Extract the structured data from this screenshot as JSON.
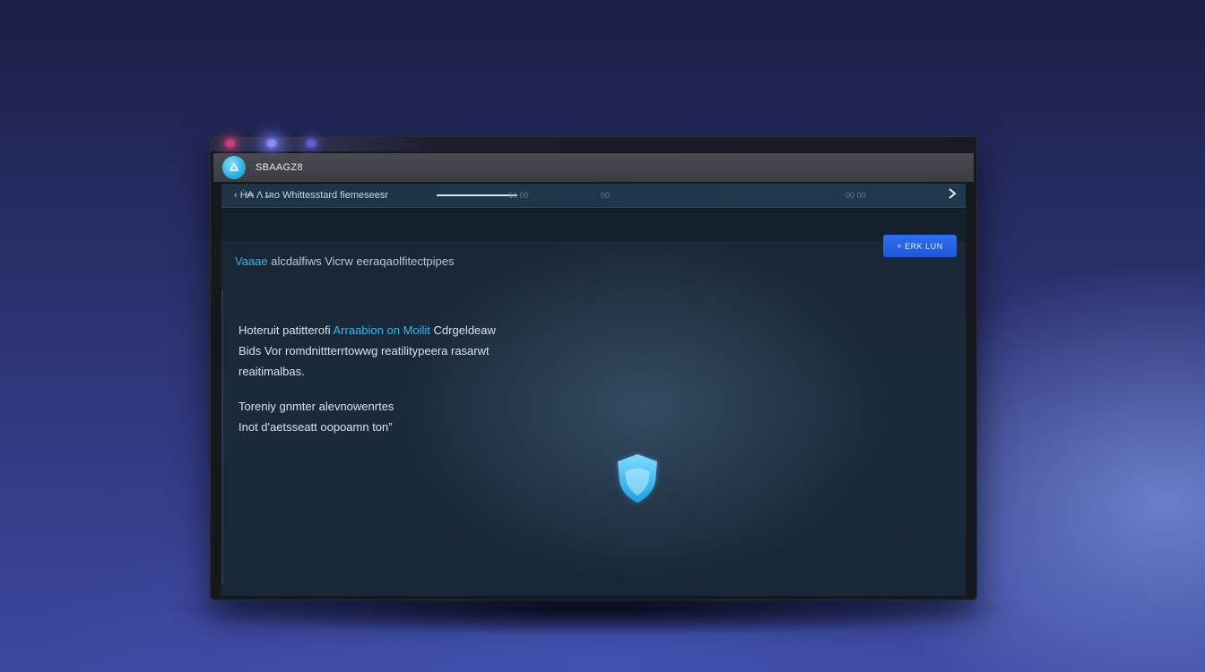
{
  "window": {
    "app_title": "SBAAGZ8"
  },
  "address_bar": {
    "url_text": "‹ Ḣ₳ Λ ȶʀo Whittesstard fiemeseesr",
    "meta_1": "10 00",
    "meta_2": "00",
    "meta_3": "00  00",
    "forward_icon": "chevron-right-icon"
  },
  "toolbar": {
    "primary_button_label": "+ ERK LUN"
  },
  "main": {
    "subtitle_highlight": "Vaaae",
    "subtitle_rest": "alcdalfiws Vicrw eeraqaolfitectpipes",
    "paragraph_1": {
      "line_1_prefix": "Hoteruit patitterofi",
      "line_1_link": "Arraabion on Moilit",
      "line_1_suffix": "Cdrgeldeaw",
      "line_2": "Bids Vor romdnittterrtowwg reatilitypeera rasarwt",
      "line_3": "reaitimalbas."
    },
    "paragraph_2": {
      "line_1": "Toreniy gnmter alevnowenrtes",
      "line_2": "Inot d'aetsseatt oopoamn ton”"
    },
    "center_icon": "shield-icon"
  },
  "colors": {
    "accent": "#2fb7ec",
    "button": "#2563eb",
    "background": "#2c3170"
  }
}
